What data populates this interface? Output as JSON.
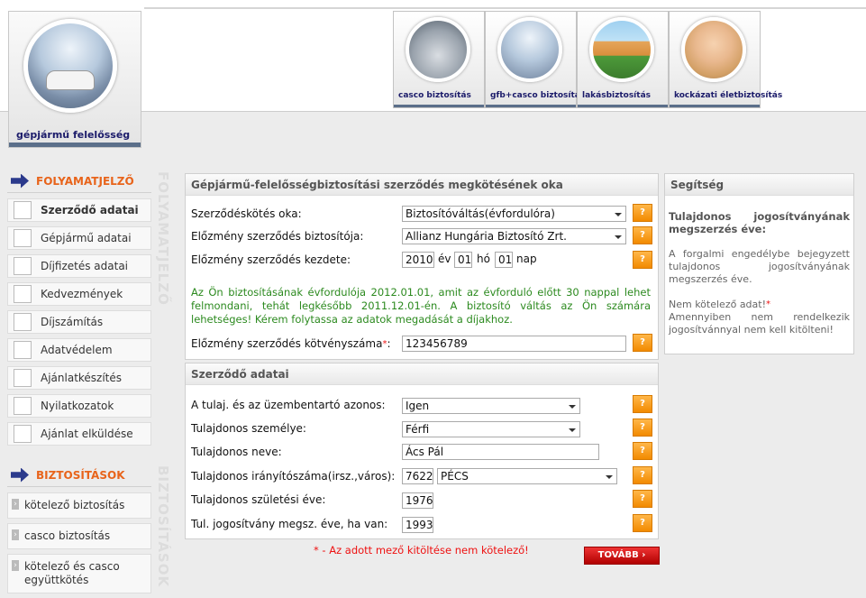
{
  "header": {
    "main_tile_label": "gépjármű felelősség",
    "products": [
      {
        "label": "casco biztosítás"
      },
      {
        "label": "gfb+casco biztosítás"
      },
      {
        "label": "lakásbiztosítás"
      },
      {
        "label": "kockázati életbiztosítás"
      }
    ]
  },
  "sidebar": {
    "progress_title": "FOLYAMATJELZŐ",
    "steps": [
      {
        "label": "Szerződő adatai"
      },
      {
        "label": "Gépjármű adatai"
      },
      {
        "label": "Díjfizetés adatai"
      },
      {
        "label": "Kedvezmények"
      },
      {
        "label": "Díjszámítás"
      },
      {
        "label": "Adatvédelem"
      },
      {
        "label": "Ajánlatkészítés"
      },
      {
        "label": "Nyilatkozatok"
      },
      {
        "label": "Ajánlat elküldése"
      }
    ],
    "insurance_title": "BIZTOSÍTÁSOK",
    "insurances": [
      {
        "label": "kötelező biztosítás"
      },
      {
        "label": "casco biztosítás"
      },
      {
        "label": "kötelező és casco együttkötés"
      }
    ],
    "vertical_progress": "FOLYAMATJELZŐ",
    "vertical_insurance": "BIZTOSÍTÁSOK"
  },
  "reason_panel": {
    "title": "Gépjármű-felelősségbiztosítási szerződés megkötésének oka",
    "reason_label": "Szerződéskötés oka:",
    "reason_value": "Biztosítóváltás(évfordulóra)",
    "prev_insurer_label": "Előzmény szerződés biztosítója:",
    "prev_insurer_value": "Allianz Hungária Biztosító Zrt.",
    "start_label": "Előzmény szerződés kezdete:",
    "year": "2010",
    "year_unit": "év",
    "month": "01",
    "month_unit": "hó",
    "day": "01",
    "day_unit": "nap",
    "notice": "Az Ön biztosításának évfordulója 2012.01.01, amit az évforduló előtt 30 nappal lehet felmondani, tehát legkésőbb 2011.12.01-én. A biztosító váltás az Ön számára lehetséges! Kérem folytassa az adatok megadását a díjakhoz.",
    "policy_label": "Előzmény szerződés kötvényszáma",
    "policy_star": "*",
    "policy_colon": ":",
    "policy_value": "123456789"
  },
  "contract_panel": {
    "title": "Szerződő adatai",
    "same_label": "A tulaj. és az üzembentartó azonos:",
    "same_value": "Igen",
    "person_label": "Tulajdonos személye:",
    "person_value": "Férfi",
    "name_label": "Tulajdonos neve:",
    "name_value": "Ács Pál",
    "zip_label": "Tulajdonos irányítószáma(irsz.,város):",
    "zip_value": "7622",
    "city_value": "PÉCS",
    "birth_label": "Tulajdonos születési éve:",
    "birth_value": "1976",
    "license_label": "Tul. jogosítvány megsz. éve, ha van:",
    "license_value": "1993"
  },
  "help": {
    "title": "Segítség",
    "help_button": "?",
    "heading": "Tulajdonos jogosítványának megszerzés éve:",
    "text1": "A forgalmi engedélybe bejegyzett tulajdonos jogosítványának megszerzés éve.",
    "text2": "Nem kötelező adat!",
    "text2_star": "*",
    "text3": "Amennyiben nem rendelkezik jogosítvánnyal nem kell kitölteni!"
  },
  "footer": {
    "note": "* - Az adott mező kitöltése nem kötelező!",
    "next_label": "TOVÁBB  ›"
  },
  "colors": {
    "accent": "#e8641b",
    "help_button": "#f28a00",
    "next_button": "#cc0000",
    "notice": "#2c8a1f"
  }
}
